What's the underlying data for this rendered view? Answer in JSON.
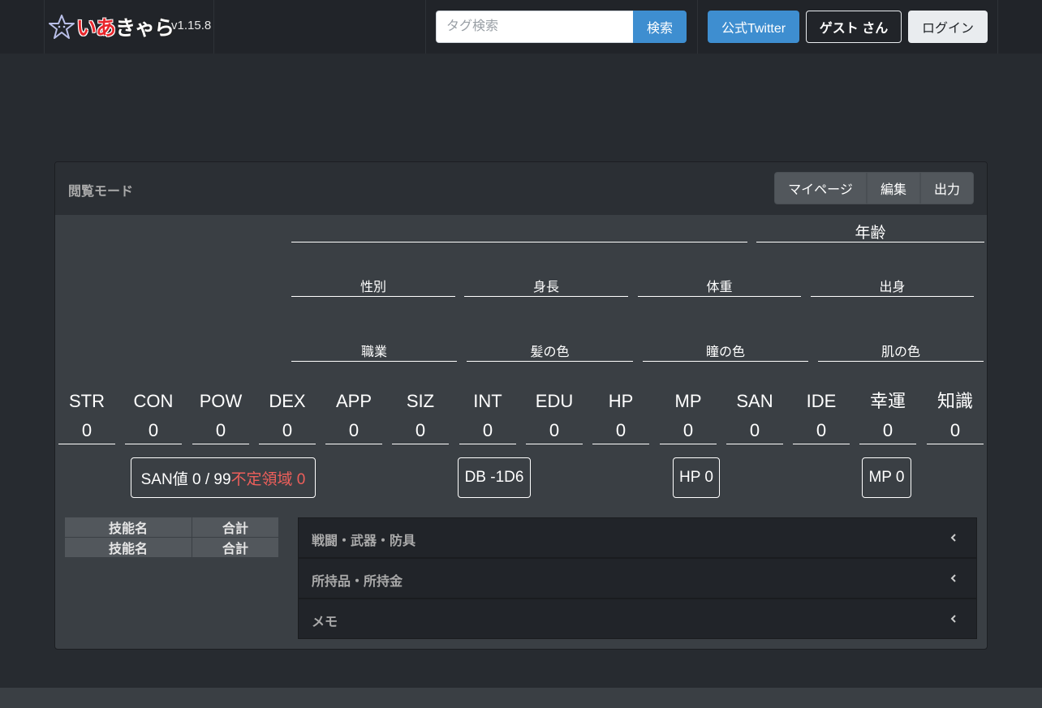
{
  "navbar": {
    "brand_red": "いあ",
    "brand_white": "きゃら",
    "version": "v1.15.8",
    "search_placeholder": "タグ検索",
    "search_label": "検索",
    "twitter_label": "公式Twitter",
    "guest_label": "ゲスト さん",
    "login_label": "ログイン"
  },
  "card": {
    "title": "閲覧モード",
    "mypage_label": "マイページ",
    "edit_label": "編集",
    "output_label": "出力"
  },
  "profile": {
    "age": "年齢",
    "gender": "性別",
    "height": "身長",
    "weight": "体重",
    "origin": "出身",
    "job": "職業",
    "hair": "髪の色",
    "eye": "瞳の色",
    "skin": "肌の色"
  },
  "stats": [
    {
      "name": "STR",
      "value": "0"
    },
    {
      "name": "CON",
      "value": "0"
    },
    {
      "name": "POW",
      "value": "0"
    },
    {
      "name": "DEX",
      "value": "0"
    },
    {
      "name": "APP",
      "value": "0"
    },
    {
      "name": "SIZ",
      "value": "0"
    },
    {
      "name": "INT",
      "value": "0"
    },
    {
      "name": "EDU",
      "value": "0"
    },
    {
      "name": "HP",
      "value": "0"
    },
    {
      "name": "MP",
      "value": "0"
    },
    {
      "name": "SAN",
      "value": "0"
    },
    {
      "name": "IDE",
      "value": "0"
    },
    {
      "name": "幸運",
      "value": "0"
    },
    {
      "name": "知識",
      "value": "0"
    }
  ],
  "badges": {
    "san": "SAN値 0 / 99",
    "unstable": "不定領域 0",
    "db": "DB -1D6",
    "hp": "HP 0",
    "mp": "MP 0"
  },
  "skills": {
    "rows": [
      {
        "name": "技能名",
        "total": "合計"
      },
      {
        "name": "技能名",
        "total": "合計"
      }
    ]
  },
  "accordion": [
    {
      "label": "戦闘・武器・防具"
    },
    {
      "label": "所持品・所持金"
    },
    {
      "label": "メモ"
    }
  ],
  "colors": {
    "accent": "#3e8ed0",
    "warning": "#ee5f5b",
    "background": "#272b30"
  }
}
